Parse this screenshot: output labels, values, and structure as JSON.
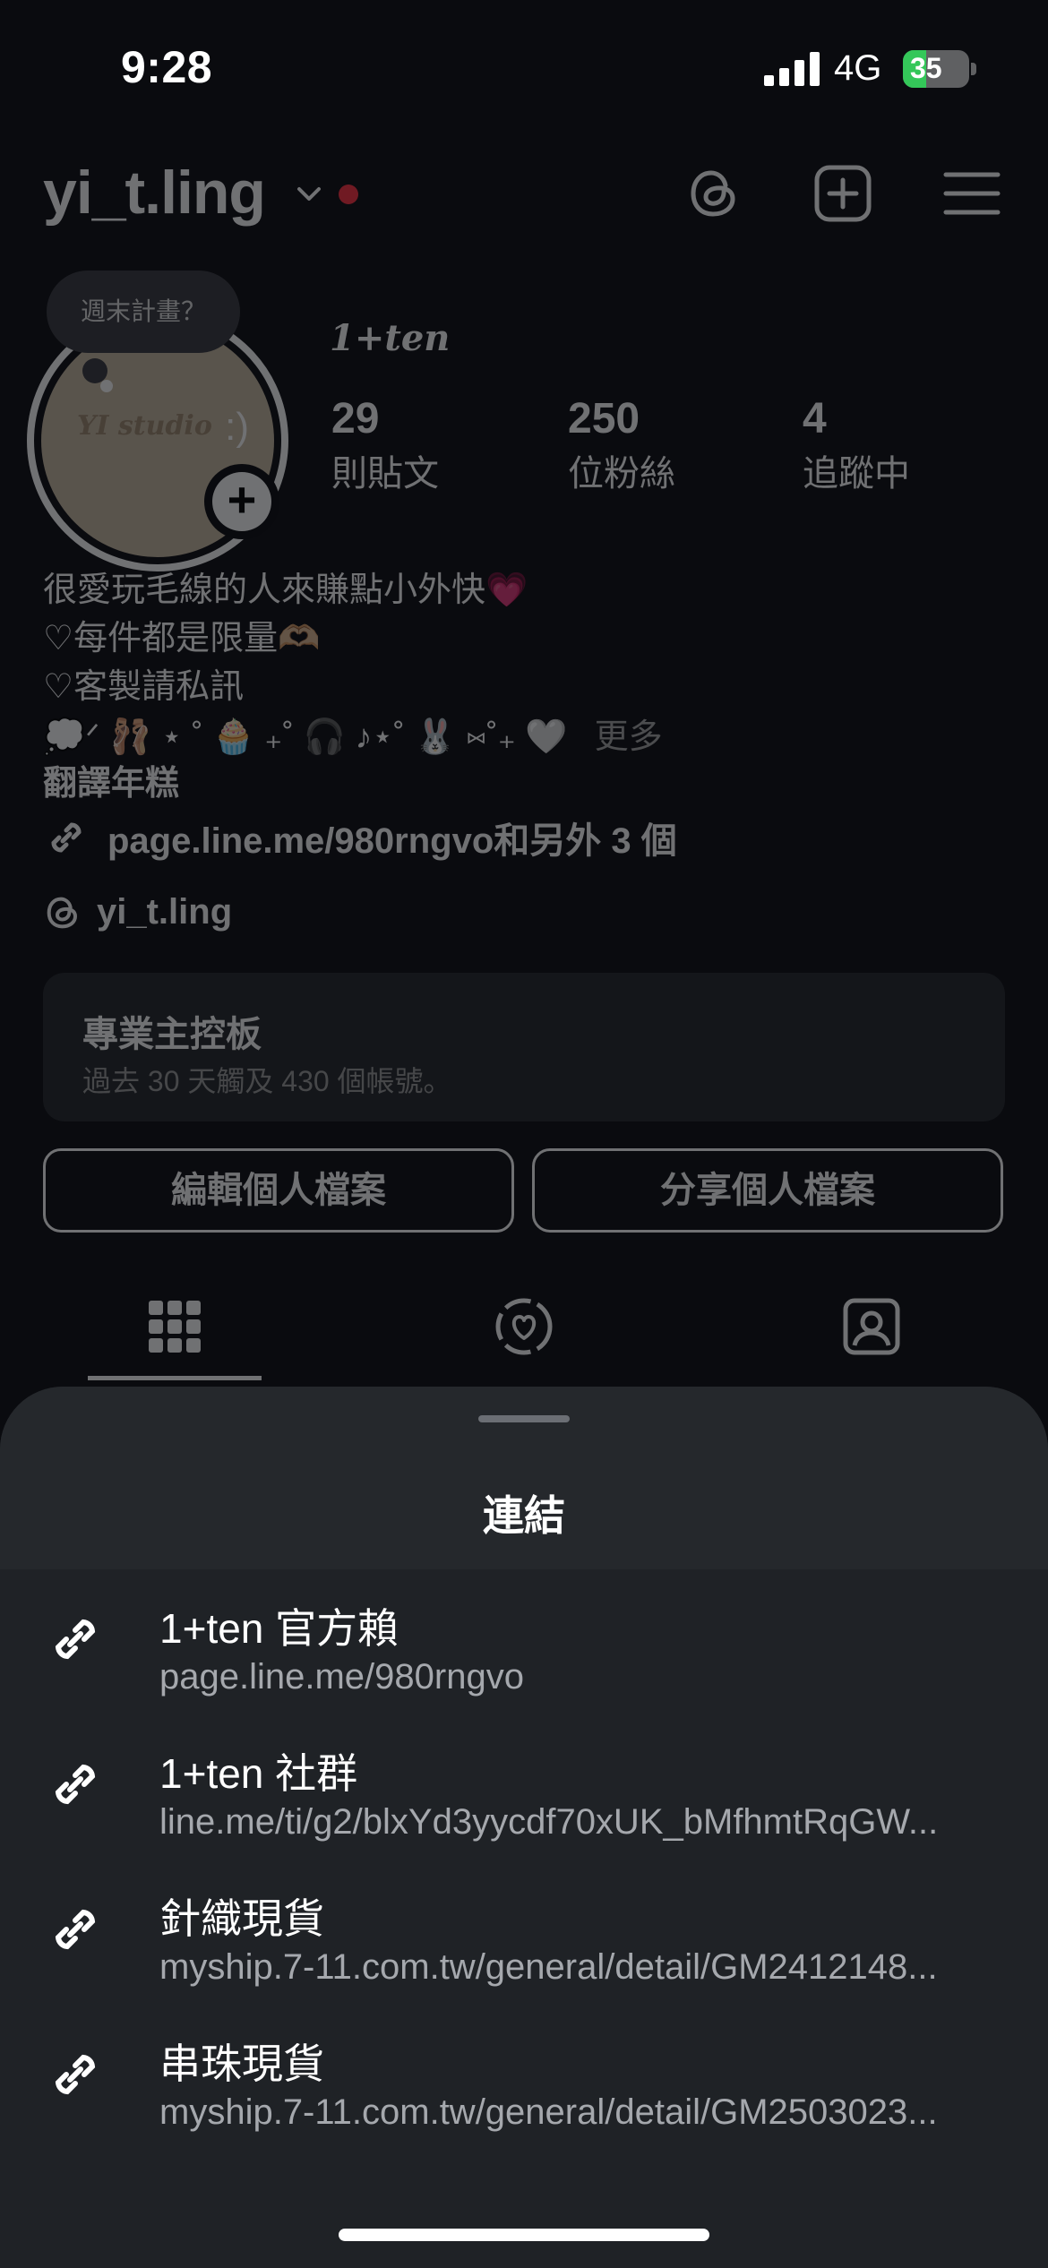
{
  "status_bar": {
    "time": "9:28",
    "network": "4G",
    "battery": "35",
    "battery_level": 0.35,
    "battery_color": "#34c759"
  },
  "profile": {
    "username": "yi_t.ling",
    "icons": [
      "threads-icon",
      "create-post-icon",
      "menu-icon"
    ],
    "note": "週末計畫？",
    "avatar_text": "YI studio",
    "avatar_smile": ":)",
    "add_badge": "+",
    "full_name": "1+𝒕𝒆𝒏",
    "stats": [
      {
        "count": "29",
        "label": "則貼文"
      },
      {
        "count": "250",
        "label": "位粉絲"
      },
      {
        "count": "4",
        "label": "追蹤中"
      }
    ],
    "bio": {
      "line1": "很愛玩毛線的人來賺點小外快💗",
      "line2": "♡每件都是限量🫶🏼",
      "line3": "♡客製請私訊",
      "line4": "💭ᐟ 🩰 ⋆ ˚ 🧁 ₊˚ 🎧 ♪⋆˚ 🐰 ⑅˚₊ 🤍",
      "more": "更多",
      "line5": "翻譯年糕"
    },
    "link_summary": "page.line.me/980rngvo和另外 3 個",
    "threads_handle": "yi_t.ling",
    "dashboard": {
      "title": "專業主控板",
      "subtitle": "過去 30 天觸及 430 個帳號。"
    },
    "buttons": {
      "edit": "編輯個人檔案",
      "share": "分享個人檔案"
    },
    "tabs": [
      "grid-icon",
      "reels-icon",
      "tagged-icon"
    ]
  },
  "sheet": {
    "title": "連結",
    "links": [
      {
        "title": "1+ten 官方賴",
        "url": "page.line.me/980rngvo"
      },
      {
        "title": "1+ten 社群",
        "url": "line.me/ti/g2/blxYd3yycdf70xUK_bMfhmtRqGW..."
      },
      {
        "title": "針織現貨",
        "url": "myship.7-11.com.tw/general/detail/GM2412148..."
      },
      {
        "title": "串珠現貨",
        "url": "myship.7-11.com.tw/general/detail/GM2503023..."
      }
    ]
  }
}
